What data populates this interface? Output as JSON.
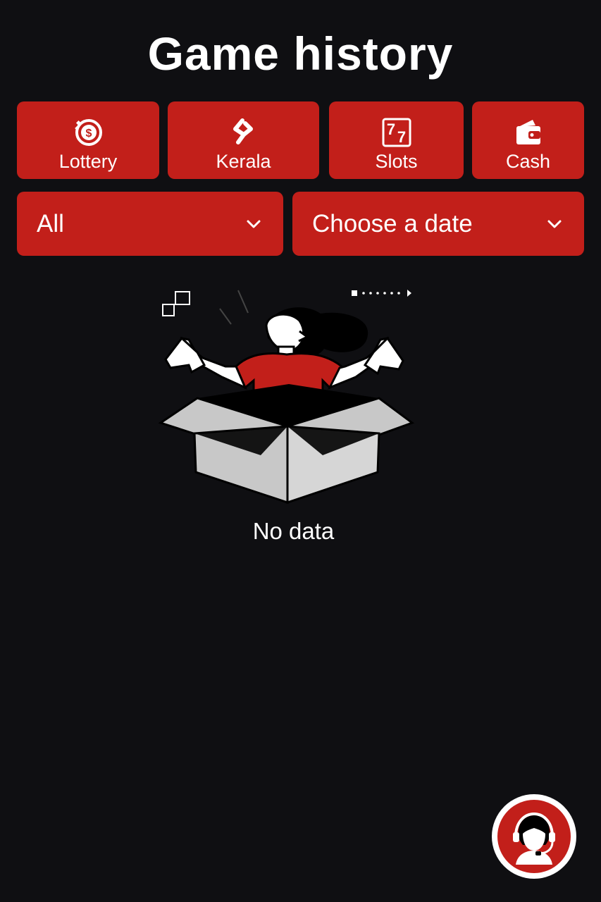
{
  "header": {
    "title": "Game history"
  },
  "categories": [
    {
      "label": "Lottery",
      "icon": "lottery-coin-icon"
    },
    {
      "label": "Kerala",
      "icon": "kerala-logo-icon"
    },
    {
      "label": "Slots",
      "icon": "slots-77-icon"
    },
    {
      "label": "Cash",
      "icon": "wallet-icon"
    }
  ],
  "filters": {
    "type_select": {
      "value": "All",
      "icon": "chevron-down-icon"
    },
    "date_select": {
      "value": "Choose a date",
      "icon": "chevron-down-icon"
    }
  },
  "empty_state": {
    "message": "No data",
    "illustration": "person-in-empty-box-illustration"
  },
  "support": {
    "icon": "customer-service-headset-icon"
  },
  "colors": {
    "background": "#0f0f12",
    "accent": "#c21f1a",
    "text": "#ffffff"
  }
}
